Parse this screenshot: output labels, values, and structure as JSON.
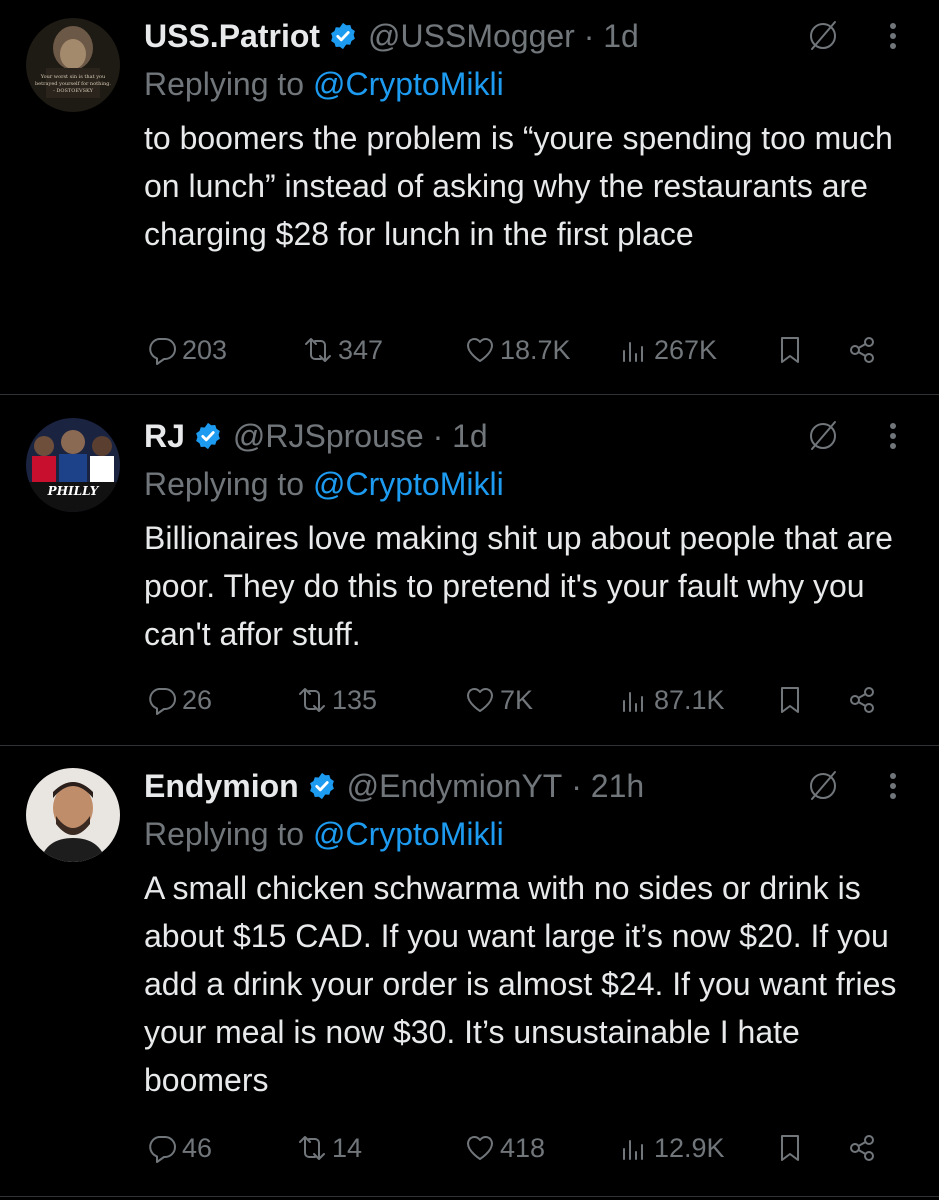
{
  "tweets": [
    {
      "name": "USS.Patriot",
      "handle": "@USSMogger",
      "time": "1d",
      "replying_prefix": "Replying to",
      "replying_to": "@CryptoMikli",
      "text": "to boomers the problem is “youre spending too much on lunch” instead of asking why the restaurants are charging $28 for lunch in the first place",
      "avatar_text": "Your worst sin is that you betrayed yourself for nothing. - DOSTOEVSKY",
      "replies": "203",
      "reposts": "347",
      "likes": "18.7K",
      "views": "267K"
    },
    {
      "name": "RJ",
      "handle": "@RJSprouse",
      "time": "1d",
      "replying_prefix": "Replying to",
      "replying_to": "@CryptoMikli",
      "text": "Billionaires love making shit up about people that are poor. They do this to pretend it's your fault why you can't affor stuff.",
      "avatar_text": "PHILLY",
      "replies": "26",
      "reposts": "135",
      "likes": "7K",
      "views": "87.1K"
    },
    {
      "name": "Endymion",
      "handle": "@EndymionYT",
      "time": "21h",
      "replying_prefix": "Replying to",
      "replying_to": "@CryptoMikli",
      "text": "A small chicken schwarma with no sides or drink is about $15 CAD. If you want large it’s now $20. If you add a drink your order is almost $24. If you want fries your meal is now $30. It’s unsustainable I hate boomers",
      "replies": "46",
      "reposts": "14",
      "likes": "418",
      "views": "12.9K"
    }
  ],
  "colors": {
    "background": "#000000",
    "text": "#e7e9ea",
    "secondary": "#71767b",
    "accent": "#1d9bf0",
    "divider": "#2f3336"
  },
  "icons": [
    "verified-badge-icon",
    "grok-icon",
    "more-icon",
    "reply-icon",
    "repost-icon",
    "like-icon",
    "views-icon",
    "bookmark-icon",
    "share-icon"
  ]
}
